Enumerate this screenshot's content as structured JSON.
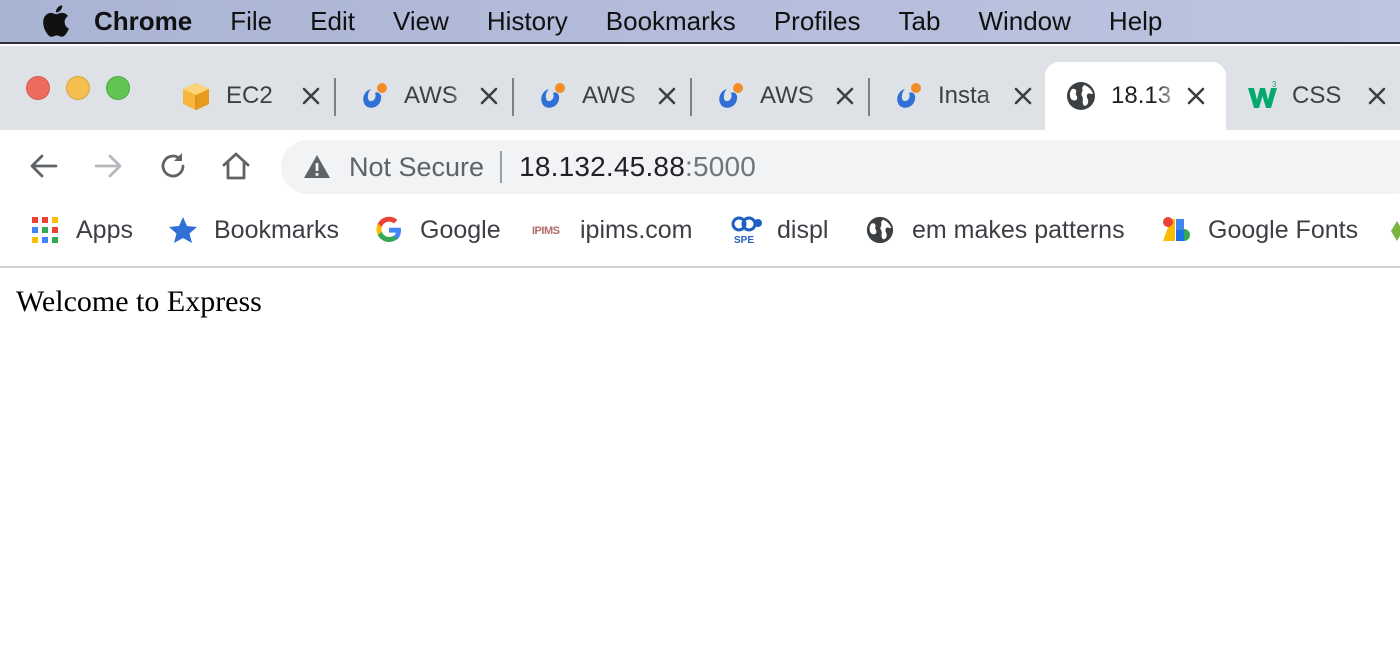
{
  "menubar": {
    "app_name": "Chrome",
    "items": [
      "File",
      "Edit",
      "View",
      "History",
      "Bookmarks",
      "Profiles",
      "Tab",
      "Window",
      "Help"
    ]
  },
  "tabs": [
    {
      "title": "EC2",
      "icon": "aws-box-icon",
      "active": false
    },
    {
      "title": "AWS",
      "icon": "swirl-icon",
      "active": false
    },
    {
      "title": "AWS",
      "icon": "swirl-icon",
      "active": false
    },
    {
      "title": "AWS",
      "icon": "swirl-icon",
      "active": false
    },
    {
      "title": "Insta",
      "icon": "swirl-icon",
      "active": false
    },
    {
      "title": "18.13",
      "icon": "globe-icon",
      "active": true
    },
    {
      "title": "CSS",
      "icon": "w3schools-icon",
      "active": false
    }
  ],
  "omnibox": {
    "security_label": "Not Secure",
    "url_host": "18.132.45.88",
    "url_port": ":5000"
  },
  "bookmarks": [
    {
      "label": "Apps",
      "icon": "apps-grid-icon"
    },
    {
      "label": "Bookmarks",
      "icon": "star-icon"
    },
    {
      "label": "Google",
      "icon": "google-icon"
    },
    {
      "label": "ipims.com",
      "icon": "ipims-icon"
    },
    {
      "label": "displ",
      "icon": "spe-icon"
    },
    {
      "label": "em makes patterns",
      "icon": "globe-icon"
    },
    {
      "label": "Google Fonts",
      "icon": "google-fonts-icon"
    }
  ],
  "page": {
    "heading": "Welcome to Express"
  },
  "colors": {
    "menubar_tint": "#b2bbd9",
    "tabstrip": "#dee1e6",
    "omnibox": "#f1f3f4"
  }
}
